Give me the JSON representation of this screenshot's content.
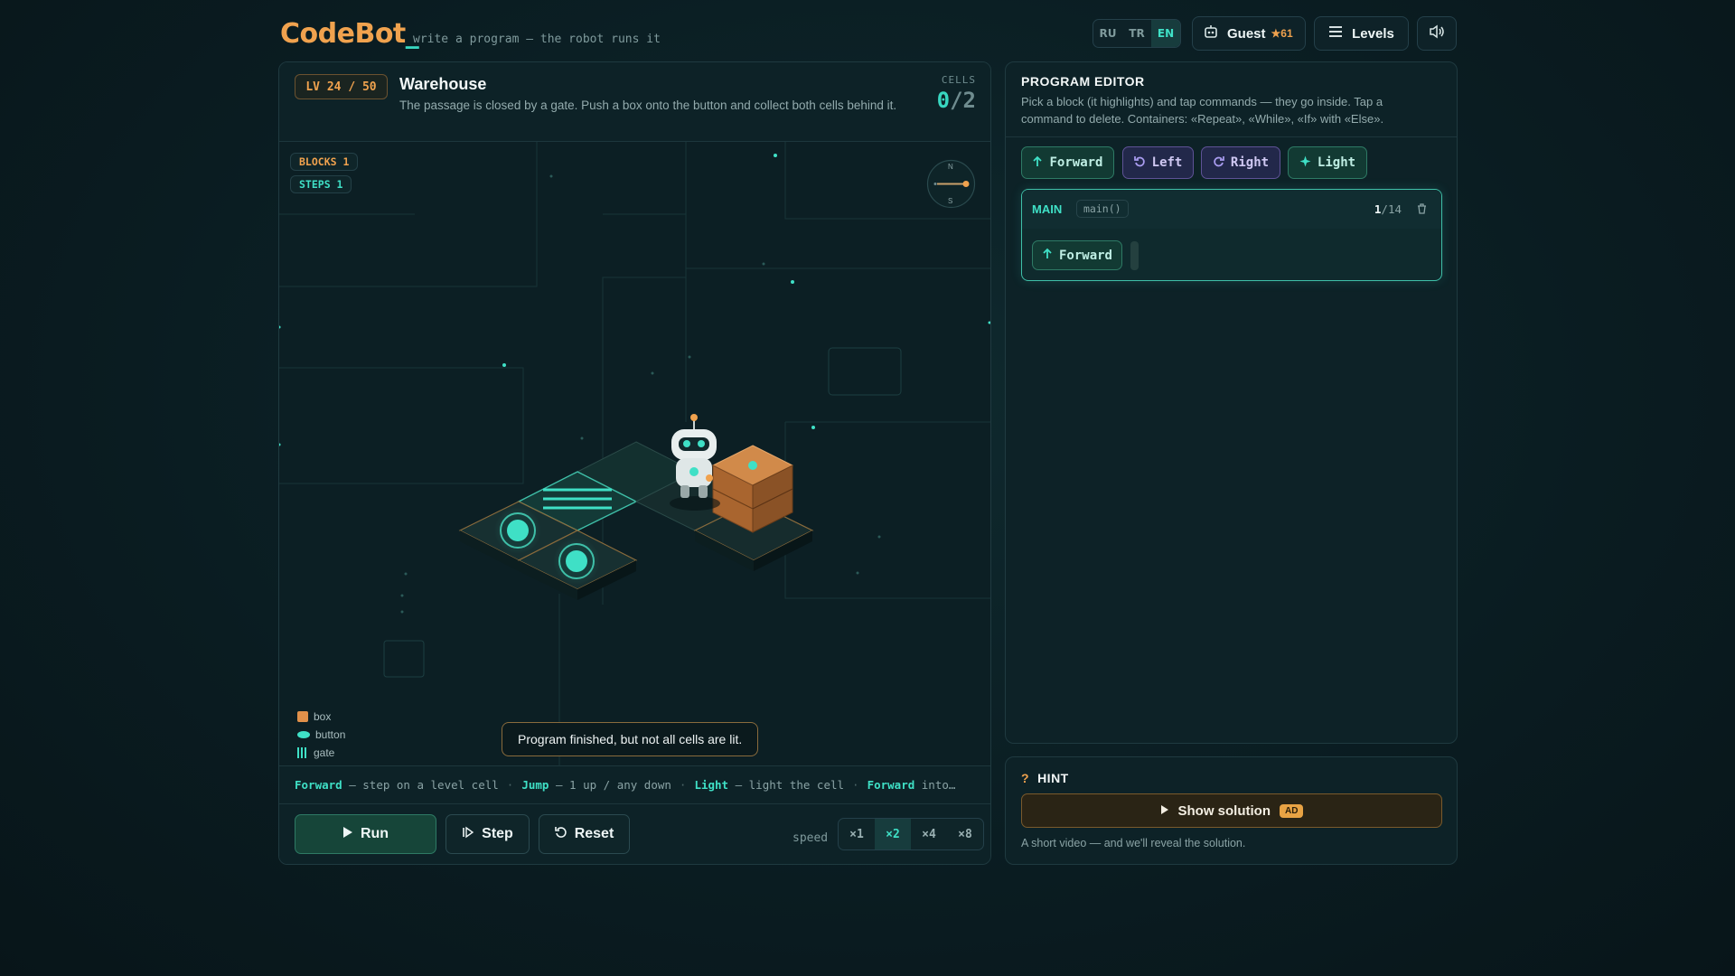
{
  "header": {
    "logo_part1": "CodeBot",
    "logo_part2": "_",
    "tagline": "write a program — the robot runs it",
    "languages": [
      "RU",
      "TR",
      "EN"
    ],
    "active_language": "EN",
    "user_name": "Guest",
    "stars": "★61",
    "levels_label": "Levels",
    "icons": {
      "user": "robot-icon",
      "menu": "menu-icon",
      "sound": "speaker-icon"
    }
  },
  "level": {
    "badge": "LV 24 / 50",
    "title": "Warehouse",
    "description": "The passage is closed by a gate. Push a box onto the button and collect both cells behind it.",
    "cells_label": "CELLS",
    "cells_lit": "0",
    "cells_total": "/2"
  },
  "stage": {
    "blocks_label": "BLOCKS 1",
    "steps_label": "STEPS 1",
    "compass": {
      "n": "N",
      "s": "S"
    },
    "legend": [
      {
        "label": "box",
        "color": "#e0904a"
      },
      {
        "label": "button",
        "color": "#3fe0c6"
      },
      {
        "label": "gate",
        "color": "#3fe0c6"
      }
    ],
    "toast": "Program finished, but not all cells are lit."
  },
  "tips": [
    {
      "key": "Forward",
      "text": "— step on a level cell"
    },
    {
      "key": "Jump",
      "text": "— 1 up / any down"
    },
    {
      "key": "Light",
      "text": "— light the cell"
    },
    {
      "key": "Forward",
      "text": "into…"
    }
  ],
  "controls": {
    "run_label": "Run",
    "step_label": "Step",
    "reset_label": "Reset",
    "speed_label": "speed",
    "speeds": [
      "×1",
      "×2",
      "×4",
      "×8"
    ],
    "active_speed": "×2"
  },
  "editor": {
    "title": "PROGRAM EDITOR",
    "description": "Pick a block (it highlights) and tap commands — they go inside. Tap a command to delete. Containers: «Repeat», «While», «If» with «Else».",
    "commands": [
      {
        "label": "Forward",
        "icon": "arrow-up-icon"
      },
      {
        "label": "Left",
        "icon": "rotate-left-icon"
      },
      {
        "label": "Right",
        "icon": "rotate-right-icon"
      },
      {
        "label": "Light",
        "icon": "sparkle-icon"
      }
    ],
    "main": {
      "label": "MAIN",
      "fn": "main()",
      "count_used": "1",
      "count_max": "/14",
      "program": [
        "Forward"
      ]
    }
  },
  "hint": {
    "title": "HINT",
    "q": "?",
    "button_label": "Show solution",
    "ad_badge": "AD",
    "note": "A short video — and we'll reveal the solution."
  },
  "colors": {
    "accent": "#3fe0c6",
    "brand_orange": "#f0a24e",
    "background": "#0a1c21",
    "panel": "#0d2227"
  }
}
